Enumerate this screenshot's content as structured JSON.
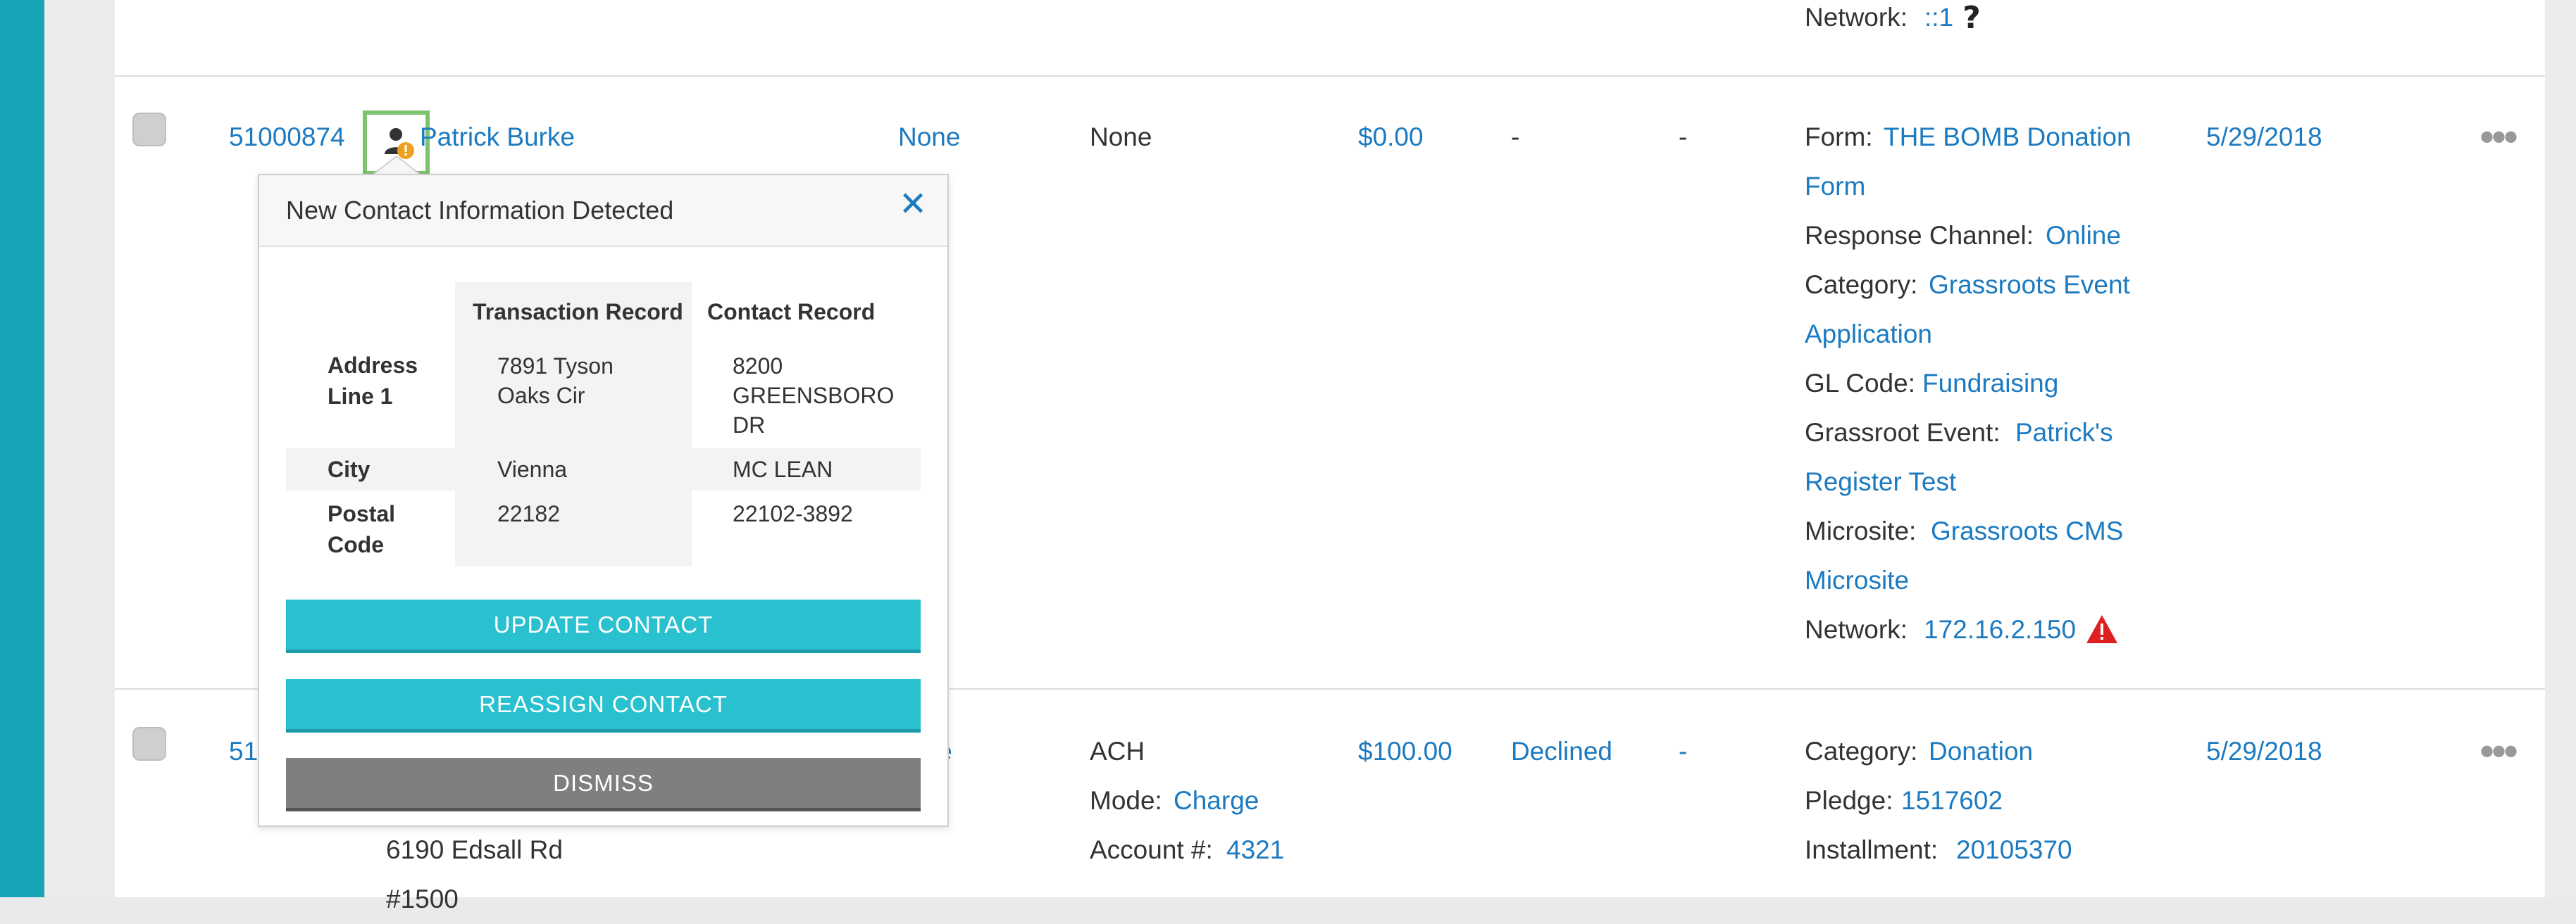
{
  "row0": {
    "network_label": "Network:",
    "network_value": "::1",
    "help_icon": "question-icon"
  },
  "row1": {
    "id": "51000874",
    "name": "Patrick Burke",
    "col_type": "None",
    "col_method": "None",
    "amount": "$0.00",
    "status": "-",
    "col7": "-",
    "details": {
      "form_label": "Form:",
      "form_value_1": "THE BOMB Donation",
      "form_value_2": "Form",
      "channel_label": "Response Channel:",
      "channel_value": "Online",
      "category_label": "Category:",
      "category_value_1": "Grassroots Event",
      "category_value_2": "Application",
      "gl_label": "GL Code:",
      "gl_value": "Fundraising",
      "event_label": "Grassroot Event:",
      "event_value_1": "Patrick's",
      "event_value_2": "Register Test",
      "microsite_label": "Microsite:",
      "microsite_value_1": "Grassroots CMS",
      "microsite_value_2": "Microsite",
      "network_label": "Network:",
      "network_value": "172.16.2.150"
    },
    "date": "5/29/2018"
  },
  "row2": {
    "id_partial": "51",
    "type_partial": "dge",
    "method": "ACH",
    "mode_label": "Mode:",
    "mode_value": "Charge",
    "account_label": "Account #:",
    "account_value": "4321",
    "amount": "$100.00",
    "status": "Declined",
    "col7": "-",
    "category_label": "Category:",
    "category_value": "Donation",
    "pledge_label": "Pledge:",
    "pledge_value": "1517602",
    "installment_label": "Installment:",
    "installment_value": "20105370",
    "date": "5/29/2018",
    "address_line": "6190 Edsall Rd",
    "address_line2": "#1500"
  },
  "popover": {
    "title": "New Contact Information Detected",
    "headers": [
      "Transaction Record",
      "Contact Record"
    ],
    "rows": [
      {
        "label": "Address Line 1",
        "transaction": "7891 Tyson Oaks Cir",
        "contact": "8200 GREENSBORO DR"
      },
      {
        "label": "City",
        "transaction": "Vienna",
        "contact": "MC LEAN"
      },
      {
        "label": "Postal Code",
        "transaction": "22182",
        "contact": "22102-3892"
      }
    ],
    "update_label": "UPDATE CONTACT",
    "reassign_label": "REASSIGN CONTACT",
    "dismiss_label": "DISMISS"
  },
  "colors": {
    "accent": "#29c0d0",
    "link": "#1c7ac0",
    "warning": "#e02020",
    "sidebar": "#17a6b8"
  }
}
